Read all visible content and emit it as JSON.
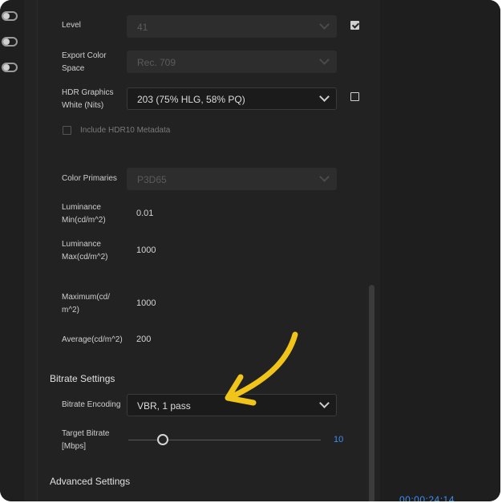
{
  "settings": {
    "level": {
      "label": "Level",
      "value": "41",
      "checked": true
    },
    "export_color_space": {
      "label_line1": "Export Color",
      "label_line2": "Space",
      "value": "Rec. 709"
    },
    "hdr_graphics_white": {
      "label_line1": "HDR Graphics",
      "label_line2": "White (Nits)",
      "value": "203 (75% HLG, 58% PQ)",
      "checked": false
    },
    "include_hdr10": {
      "label": "Include HDR10 Metadata",
      "checked": false
    },
    "color_primaries": {
      "label": "Color Primaries",
      "value": "P3D65"
    },
    "luminance_min": {
      "label_line1": "Luminance",
      "label_line2": "Min(cd/m^2)",
      "value": "0.01"
    },
    "luminance_max": {
      "label_line1": "Luminance",
      "label_line2": "Max(cd/m^2)",
      "value": "1000"
    },
    "maximum": {
      "label_line1": "Maximum(cd/",
      "label_line2": "m^2)",
      "value": "1000"
    },
    "average": {
      "label": "Average(cd/m^2)",
      "value": "200"
    }
  },
  "bitrate": {
    "section_title": "Bitrate Settings",
    "encoding_label": "Bitrate Encoding",
    "encoding_value": "VBR, 1 pass",
    "target_label_line1": "Target Bitrate",
    "target_label_line2": "[Mbps]",
    "target_value": "10",
    "target_fraction": 0.18
  },
  "advanced": {
    "section_title": "Advanced Settings"
  },
  "timecode": "00;00;24;14",
  "colors": {
    "accent": "#3d8ef0",
    "arrow": "#f0c419",
    "background": "#232323"
  }
}
